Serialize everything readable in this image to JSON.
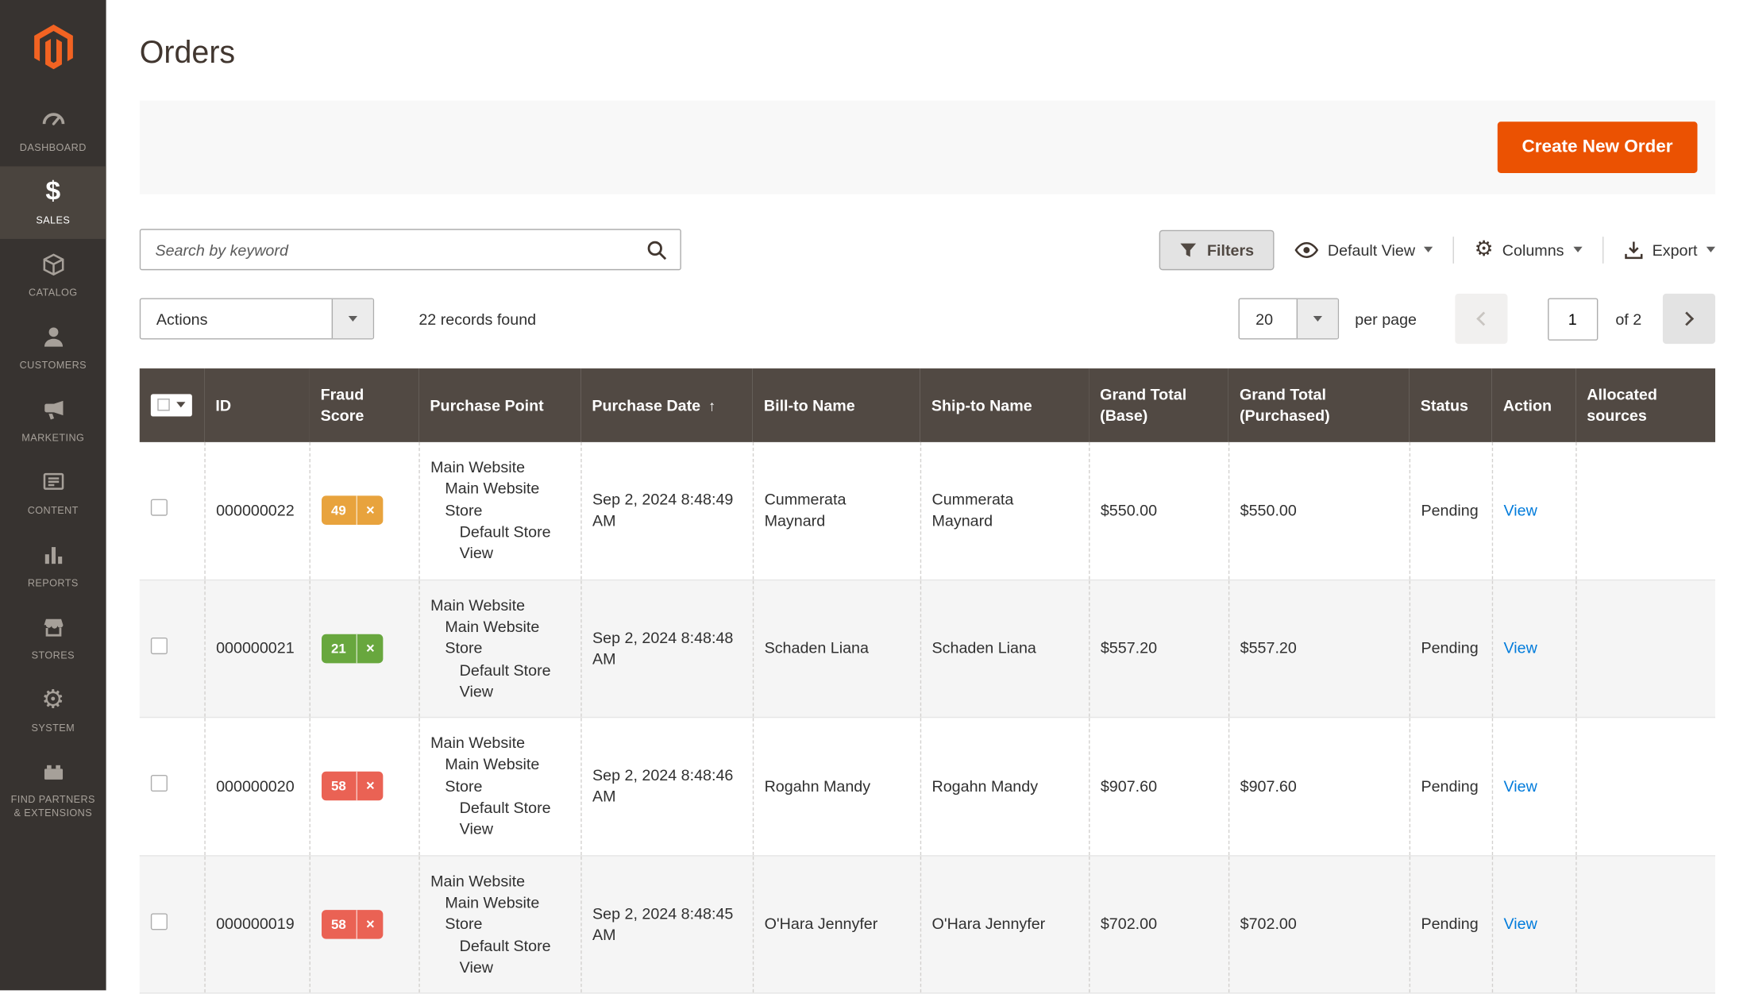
{
  "colors": {
    "accent_orange": "#eb5202",
    "logo_orange": "#f26322",
    "sidebar_bg": "#373330",
    "sidebar_active_bg": "#4a443e",
    "table_header_bg": "#514943",
    "link_blue": "#007bdb",
    "row_stripe": "#f5f5f5",
    "fraud_amber": "#e8a33d",
    "fraud_green": "#68a73e",
    "fraud_red": "#ea6254"
  },
  "icons": {
    "close": "×",
    "sort_ascending": "↑",
    "gear_glyph": "⚙",
    "dollar_glyph": "$"
  },
  "sidebar": {
    "items": [
      {
        "label": "DASHBOARD"
      },
      {
        "label": "SALES"
      },
      {
        "label": "CATALOG"
      },
      {
        "label": "CUSTOMERS"
      },
      {
        "label": "MARKETING"
      },
      {
        "label": "CONTENT"
      },
      {
        "label": "REPORTS"
      },
      {
        "label": "STORES"
      },
      {
        "label": "SYSTEM"
      },
      {
        "label": "FIND PARTNERS & EXTENSIONS"
      }
    ]
  },
  "header": {
    "title": "Orders",
    "create_button_label": "Create New Order"
  },
  "toolbar": {
    "search_placeholder": "Search by keyword",
    "filters_label": "Filters",
    "view_label": "Default View",
    "columns_label": "Columns",
    "export_label": "Export"
  },
  "controls": {
    "actions_label": "Actions",
    "records_text": "22 records found",
    "page_size": "20",
    "per_page_label": "per page",
    "current_page": "1",
    "total_pages_label": "of 2"
  },
  "table": {
    "columns": [
      "ID",
      "Fraud Score",
      "Purchase Point",
      "Purchase Date",
      "Bill-to Name",
      "Ship-to Name",
      "Grand Total (Base)",
      "Grand Total (Purchased)",
      "Status",
      "Action",
      "Allocated sources"
    ],
    "rows": [
      {
        "id": "000000022",
        "fraud_score": "49",
        "fraud_color": "#e8a33d",
        "purchase_point": [
          "Main Website",
          "Main Website Store",
          "Default Store View"
        ],
        "purchase_date": "Sep 2, 2024 8:48:49 AM",
        "bill_to": "Cummerata Maynard",
        "ship_to": "Cummerata Maynard",
        "grand_total_base": "$550.00",
        "grand_total_purchased": "$550.00",
        "status": "Pending",
        "action": "View"
      },
      {
        "id": "000000021",
        "fraud_score": "21",
        "fraud_color": "#68a73e",
        "purchase_point": [
          "Main Website",
          "Main Website Store",
          "Default Store View"
        ],
        "purchase_date": "Sep 2, 2024 8:48:48 AM",
        "bill_to": "Schaden Liana",
        "ship_to": "Schaden Liana",
        "grand_total_base": "$557.20",
        "grand_total_purchased": "$557.20",
        "status": "Pending",
        "action": "View"
      },
      {
        "id": "000000020",
        "fraud_score": "58",
        "fraud_color": "#ea6254",
        "purchase_point": [
          "Main Website",
          "Main Website Store",
          "Default Store View"
        ],
        "purchase_date": "Sep 2, 2024 8:48:46 AM",
        "bill_to": "Rogahn Mandy",
        "ship_to": "Rogahn Mandy",
        "grand_total_base": "$907.60",
        "grand_total_purchased": "$907.60",
        "status": "Pending",
        "action": "View"
      },
      {
        "id": "000000019",
        "fraud_score": "58",
        "fraud_color": "#ea6254",
        "purchase_point": [
          "Main Website",
          "Main Website Store",
          "Default Store View"
        ],
        "purchase_date": "Sep 2, 2024 8:48:45 AM",
        "bill_to": "O'Hara Jennyfer",
        "ship_to": "O'Hara Jennyfer",
        "grand_total_base": "$702.00",
        "grand_total_purchased": "$702.00",
        "status": "Pending",
        "action": "View"
      }
    ]
  }
}
